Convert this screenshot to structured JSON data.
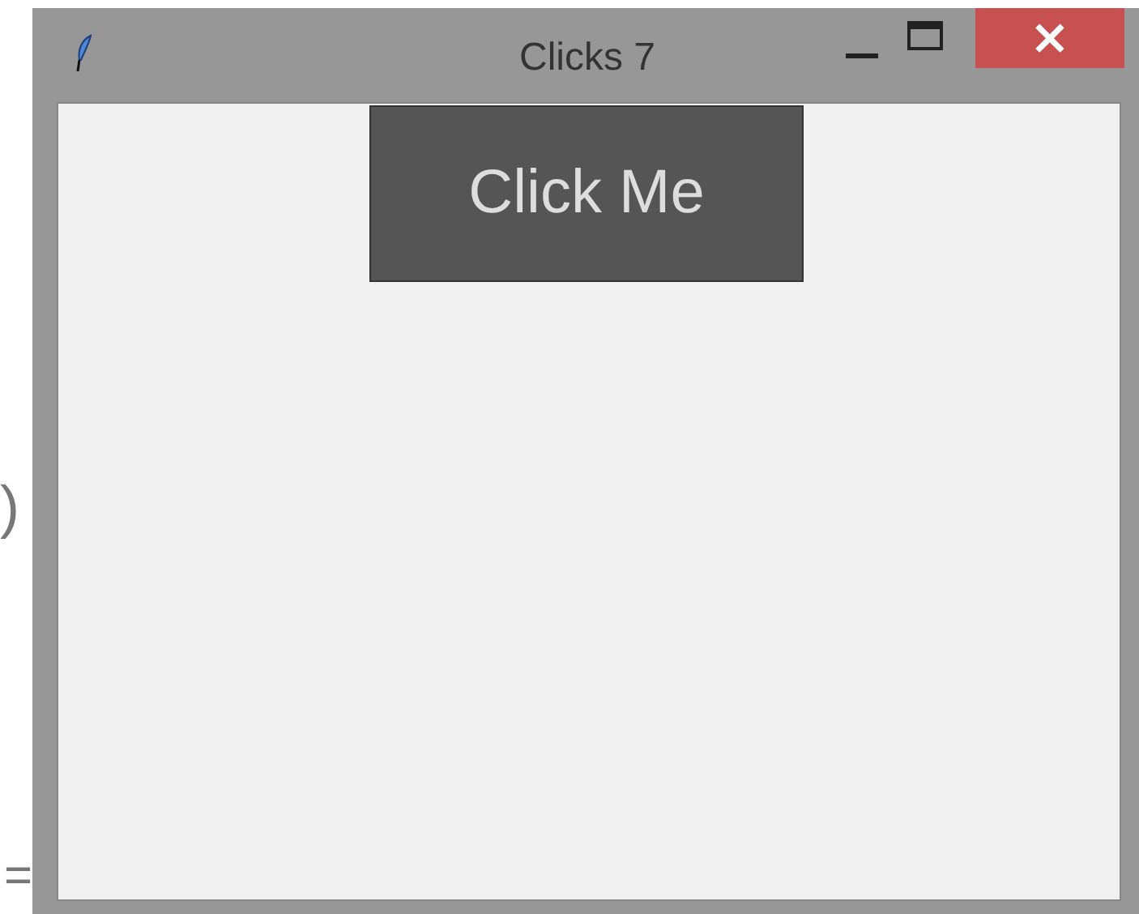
{
  "backdrop": {
    "fragments": [
      ")",
      "="
    ]
  },
  "window": {
    "title": "Clicks 7"
  },
  "button": {
    "label": "Click Me"
  },
  "title_controls": {
    "close": "×"
  }
}
